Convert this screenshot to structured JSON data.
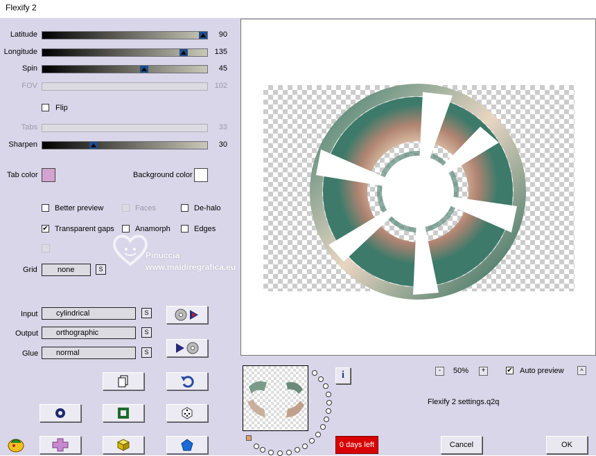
{
  "window": {
    "title": "Flexify 2"
  },
  "sliders": [
    {
      "key": "latitude",
      "label": "Latitude",
      "value": "90",
      "fraction": 1.0,
      "enabled": true
    },
    {
      "key": "longitude",
      "label": "Longitude",
      "value": "135",
      "fraction": 0.875,
      "enabled": true
    },
    {
      "key": "spin",
      "label": "Spin",
      "value": "45",
      "fraction": 0.625,
      "enabled": true
    },
    {
      "key": "fov",
      "label": "FOV",
      "value": "102",
      "fraction": 0.0,
      "enabled": false
    },
    {
      "key": "tabs",
      "label": "Tabs",
      "value": "33",
      "fraction": 0.0,
      "enabled": false
    },
    {
      "key": "sharpen",
      "label": "Sharpen",
      "value": "30",
      "fraction": 0.3,
      "enabled": true
    }
  ],
  "flip": {
    "label": "Flip",
    "checked": false
  },
  "colors": {
    "tab_color_label": "Tab color",
    "tab_color": "#d5a3cf",
    "background_color_label": "Background color",
    "background_color": "#ffffff"
  },
  "options": {
    "better_preview": {
      "label": "Better preview",
      "checked": false
    },
    "faces": {
      "label": "Faces",
      "checked": false,
      "enabled": false
    },
    "de_halo": {
      "label": "De-halo",
      "checked": false
    },
    "transparent_gaps": {
      "label": "Transparent gaps",
      "checked": true
    },
    "anamorph": {
      "label": "Anamorph",
      "checked": false
    },
    "edges": {
      "label": "Edges",
      "checked": false
    }
  },
  "grid": {
    "label": "Grid",
    "value": "none",
    "s": "S"
  },
  "projection": {
    "input": {
      "label": "Input",
      "value": "cylindrical",
      "s": "S"
    },
    "output": {
      "label": "Output",
      "value": "orthographic",
      "s": "S"
    },
    "glue": {
      "label": "Glue",
      "value": "normal",
      "s": "S"
    }
  },
  "watermark": {
    "name": "Pinuccia",
    "url": "www.maidiregrafica.eu"
  },
  "zoom": {
    "value": "50%",
    "minus": "-",
    "plus": "+"
  },
  "auto_preview": {
    "label": "Auto preview",
    "checked": true,
    "toggle": "^"
  },
  "settings_file": "Flexify 2 settings.q2q",
  "trial": {
    "label": "0 days left"
  },
  "buttons": {
    "cancel": "Cancel",
    "ok": "OK",
    "info": "i"
  },
  "accent_colors": {
    "slider_thumb": "#1f4e8c",
    "trial_bg": "#d80000",
    "panel_bg": "#d8d6e8"
  }
}
